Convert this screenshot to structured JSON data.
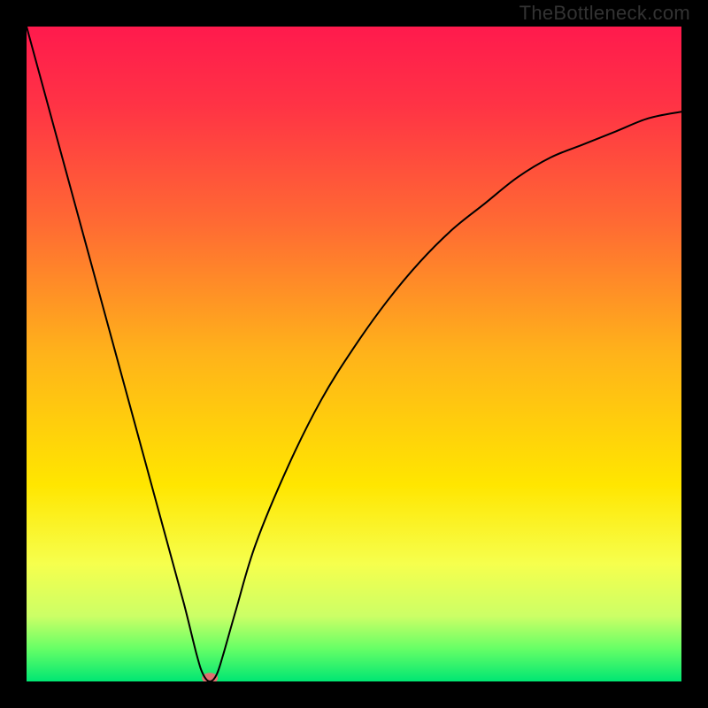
{
  "watermark": "TheBottleneck.com",
  "chart_data": {
    "type": "line",
    "title": "",
    "xlabel": "",
    "ylabel": "",
    "xlim": [
      0,
      100
    ],
    "ylim": [
      0,
      100
    ],
    "grid": false,
    "axes_visible": false,
    "legend": false,
    "background": {
      "type": "vertical-gradient",
      "stops": [
        {
          "offset": 0.0,
          "color": "#ff1a4d"
        },
        {
          "offset": 0.12,
          "color": "#ff3345"
        },
        {
          "offset": 0.3,
          "color": "#ff6a33"
        },
        {
          "offset": 0.5,
          "color": "#ffb31a"
        },
        {
          "offset": 0.7,
          "color": "#ffe600"
        },
        {
          "offset": 0.82,
          "color": "#f6ff4d"
        },
        {
          "offset": 0.9,
          "color": "#ccff66"
        },
        {
          "offset": 0.95,
          "color": "#66ff66"
        },
        {
          "offset": 1.0,
          "color": "#00e673"
        }
      ]
    },
    "series": [
      {
        "name": "bottleneck-curve",
        "color": "#000000",
        "stroke_width": 2,
        "x": [
          0,
          3,
          6,
          9,
          12,
          15,
          18,
          21,
          24,
          26,
          27,
          28,
          29,
          30,
          32,
          35,
          40,
          45,
          50,
          55,
          60,
          65,
          70,
          75,
          80,
          85,
          90,
          95,
          100
        ],
        "y": [
          100,
          89,
          78,
          67,
          56,
          45,
          34,
          23,
          12,
          4,
          1,
          0,
          1,
          4,
          11,
          21,
          33,
          43,
          51,
          58,
          64,
          69,
          73,
          77,
          80,
          82,
          84,
          86,
          87
        ]
      }
    ],
    "markers": [
      {
        "name": "min-marker",
        "x": 28,
        "y": 0.5,
        "color": "#e07070",
        "rx": 9,
        "ry": 6
      }
    ]
  }
}
